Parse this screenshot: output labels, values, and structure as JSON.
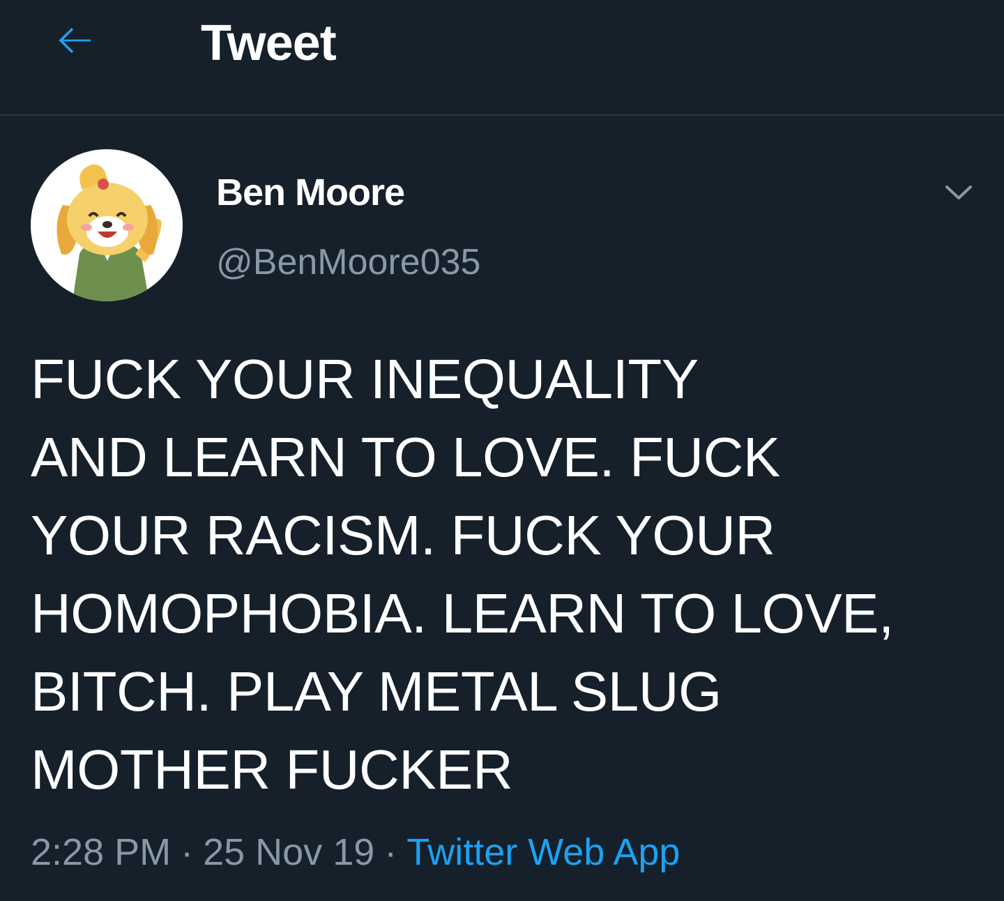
{
  "header": {
    "back_icon": "arrow-left-icon",
    "title": "Tweet"
  },
  "tweet": {
    "avatar_icon": "cartoon-dog-avatar",
    "display_name": "Ben Moore",
    "handle": "@BenMoore035",
    "caret_icon": "chevron-down-icon",
    "text": "FUCK YOUR INEQUALITY\nAND LEARN TO LOVE. FUCK\nYOUR RACISM. FUCK YOUR\nHOMOPHOBIA. LEARN TO LOVE,\nBITCH. PLAY METAL SLUG\nMOTHER FUCKER",
    "time": "2:28 PM",
    "separator": "·",
    "date": "25 Nov 19",
    "source": "Twitter Web App"
  },
  "colors": {
    "background": "#15202b",
    "accent": "#1da1f2",
    "secondary_text": "#8899a6",
    "divider": "#2a3744"
  }
}
